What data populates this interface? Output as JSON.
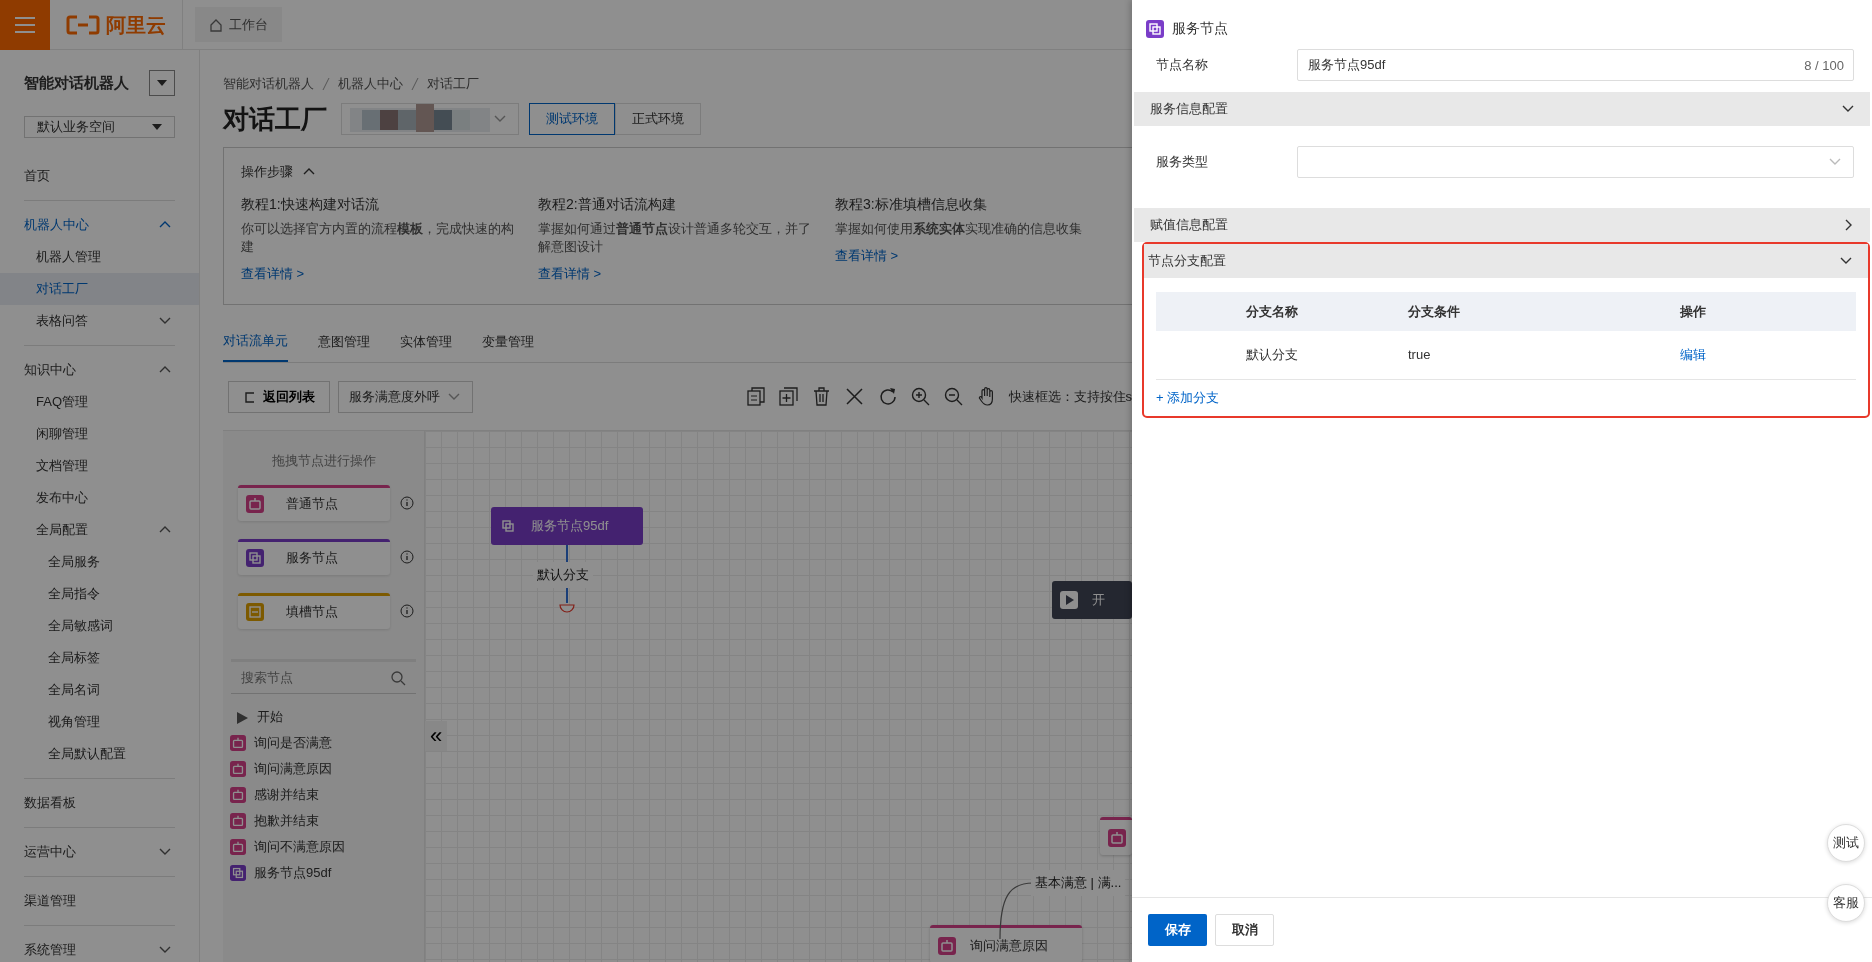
{
  "topbar": {
    "logo": "阿里云",
    "tab": "工作台"
  },
  "sidebar": {
    "title": "智能对话机器人",
    "workspace": "默认业务空间",
    "items": [
      {
        "label": "首页",
        "selected": false
      },
      {
        "label": "机器人中心",
        "selected": false,
        "expanded": true,
        "children": [
          {
            "label": "机器人管理",
            "selected": false
          },
          {
            "label": "对话工厂",
            "selected": true
          },
          {
            "label": "表格问答",
            "selected": false,
            "expanded": false
          }
        ]
      },
      {
        "label": "知识中心",
        "selected": false,
        "expanded": true,
        "children": [
          {
            "label": "FAQ管理",
            "selected": false
          },
          {
            "label": "闲聊管理",
            "selected": false
          },
          {
            "label": "文档管理",
            "selected": false
          },
          {
            "label": "发布中心",
            "selected": false
          },
          {
            "label": "全局配置",
            "selected": false,
            "expanded": true,
            "children": [
              {
                "label": "全局服务",
                "selected": false
              },
              {
                "label": "全局指令",
                "selected": false
              },
              {
                "label": "全局敏感词",
                "selected": false
              },
              {
                "label": "全局标签",
                "selected": false
              },
              {
                "label": "全局名词",
                "selected": false
              },
              {
                "label": "视角管理",
                "selected": false
              },
              {
                "label": "全局默认配置",
                "selected": false
              }
            ]
          }
        ]
      },
      {
        "label": "数据看板",
        "selected": false
      },
      {
        "label": "运营中心",
        "selected": false,
        "expanded": false
      },
      {
        "label": "渠道管理",
        "selected": false
      },
      {
        "label": "系统管理",
        "selected": false,
        "expanded": false
      }
    ]
  },
  "breadcrumb": [
    "智能对话机器人",
    "机器人中心",
    "对话工厂"
  ],
  "page_title": "对话工厂",
  "env_buttons": [
    {
      "label": "测试环境",
      "selected": true
    },
    {
      "label": "正式环境",
      "selected": false
    }
  ],
  "steps": {
    "title": "操作步骤",
    "expanded": true,
    "tutorials": [
      {
        "title": "教程1:快速构建对话流",
        "text": "你可以选择官方内置的流程**模板**，完成快速的构建",
        "link": "查看详情 >"
      },
      {
        "title": "教程2:普通对话流构建",
        "text": "掌握如何通过**普通节点**设计普通多轮交互，并了解意图设计",
        "link": "查看详情 >"
      },
      {
        "title": "教程3:标准填槽信息收集",
        "text": "掌握如何使用**系统实体**实现准确的信息收集",
        "link": "查看详情 >"
      }
    ]
  },
  "tabs": [
    {
      "label": "对话流单元",
      "selected": true
    },
    {
      "label": "意图管理",
      "selected": false
    },
    {
      "label": "实体管理",
      "selected": false
    },
    {
      "label": "变量管理",
      "selected": false
    }
  ],
  "toolbar": {
    "back": "返回列表",
    "flow": "服务满意度外呼",
    "hint": "快速框选：支持按住s"
  },
  "palette": {
    "hint": "拖拽节点进行操作",
    "node_types": [
      {
        "label": "普通节点",
        "kind": "normal"
      },
      {
        "label": "服务节点",
        "kind": "service"
      },
      {
        "label": "填槽节点",
        "kind": "slot"
      }
    ],
    "search_placeholder": "搜索节点",
    "collapse": "«",
    "nodes": [
      {
        "label": "开始",
        "kind": "start"
      },
      {
        "label": "询问是否满意",
        "kind": "normal"
      },
      {
        "label": "询问满意原因",
        "kind": "normal"
      },
      {
        "label": "感谢并结束",
        "kind": "normal"
      },
      {
        "label": "抱歉并结束",
        "kind": "normal"
      },
      {
        "label": "询问不满意原因",
        "kind": "normal"
      },
      {
        "label": "服务节点95df",
        "kind": "service"
      }
    ]
  },
  "canvas": {
    "nodes": [
      {
        "label": "服务节点95df",
        "kind": "service"
      },
      {
        "label": "开",
        "kind": "start"
      },
      {
        "kind": "normal"
      },
      {
        "label": "询问满意原因",
        "kind": "normal"
      }
    ],
    "edge_labels": [
      "默认分支",
      "基本满意 | 满..."
    ]
  },
  "drawer": {
    "title": "服务节点",
    "name_field": {
      "label": "节点名称",
      "value": "服务节点95df",
      "counter": "8 / 100"
    },
    "sections": [
      {
        "title": "服务信息配置",
        "expanded": true,
        "highlighted": false,
        "kind": "form",
        "fields": [
          {
            "label": "服务类型"
          }
        ]
      },
      {
        "title": "赋值信息配置",
        "expanded": false,
        "highlighted": false
      },
      {
        "title": "节点分支配置",
        "expanded": true,
        "highlighted": true,
        "kind": "table",
        "columns": [
          "分支名称",
          "分支条件",
          "操作"
        ],
        "rows": [
          [
            "默认分支",
            "true",
            "编辑"
          ]
        ],
        "add_link": "+ 添加分支"
      }
    ],
    "buttons": [
      {
        "label": "保存",
        "kind": "primary"
      },
      {
        "label": "取消",
        "kind": "secondary"
      }
    ]
  },
  "float_buttons": [
    "测试",
    "客服"
  ]
}
